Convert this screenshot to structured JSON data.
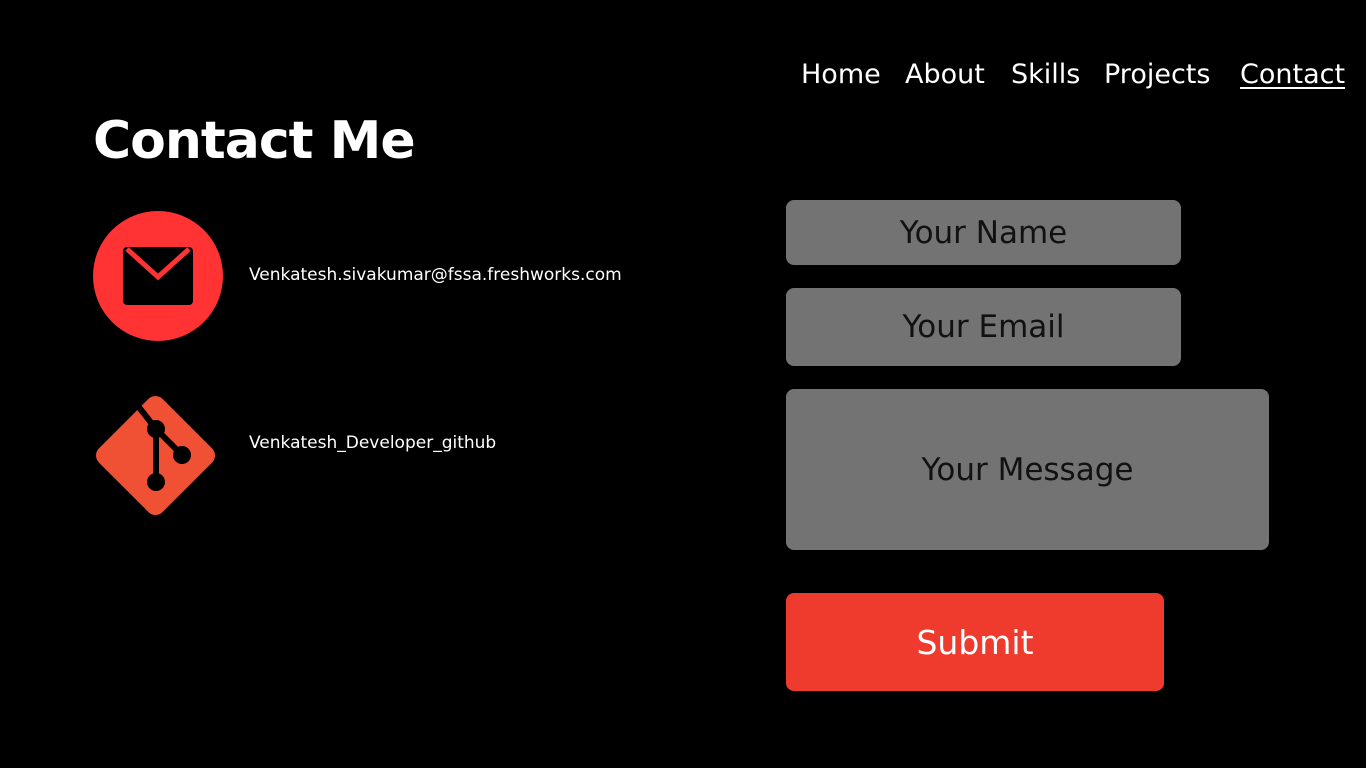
{
  "nav": {
    "items": [
      {
        "label": "Home"
      },
      {
        "label": "About"
      },
      {
        "label": "Skills"
      },
      {
        "label": "Projects"
      },
      {
        "label": "Contact",
        "active": true
      }
    ]
  },
  "page": {
    "title": "Contact Me"
  },
  "contact": {
    "email": {
      "icon": "mail-icon",
      "text": "Venkatesh.sivakumar@fssa.freshworks.com"
    },
    "github": {
      "icon": "git-icon",
      "text": "Venkatesh_Developer_github"
    }
  },
  "form": {
    "name_placeholder": "Your Name",
    "email_placeholder": "Your Email",
    "message_placeholder": "Your Message",
    "submit_label": "Submit"
  },
  "colors": {
    "background": "#000000",
    "accent": "#ef3b2d",
    "mail_circle": "#ff3333",
    "field_bg": "#737373"
  }
}
